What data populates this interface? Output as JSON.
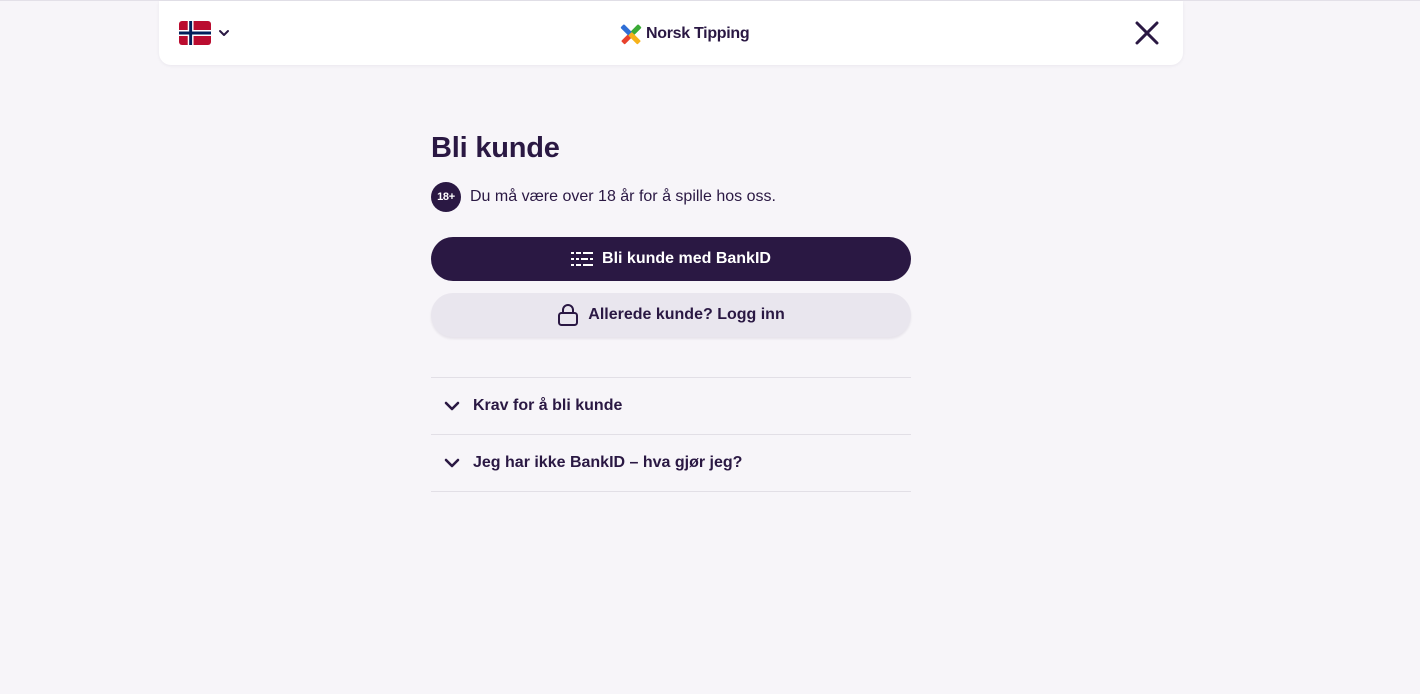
{
  "header": {
    "language_icon": "norway-flag-icon",
    "brand_name": "Norsk Tipping",
    "close_icon": "close-icon"
  },
  "main": {
    "title": "Bli kunde",
    "age_badge": "18+",
    "age_notice": "Du må være over 18 år for å spille hos oss.",
    "bankid_button_label": "Bli kunde med BankID",
    "bankid_icon": "bankid-icon",
    "login_button_label": "Allerede kunde? Logg inn",
    "login_icon": "lock-icon"
  },
  "accordion": {
    "items": [
      {
        "label": "Krav for å bli kunde",
        "expanded": false
      },
      {
        "label": "Jeg har ikke BankID – hva gjør jeg?",
        "expanded": false
      }
    ]
  },
  "colors": {
    "primary": "#2a1843",
    "background": "#f7f5f9",
    "secondary_button": "#e9e6ee",
    "flag_red": "#ba0c2f",
    "flag_blue": "#00205b"
  }
}
